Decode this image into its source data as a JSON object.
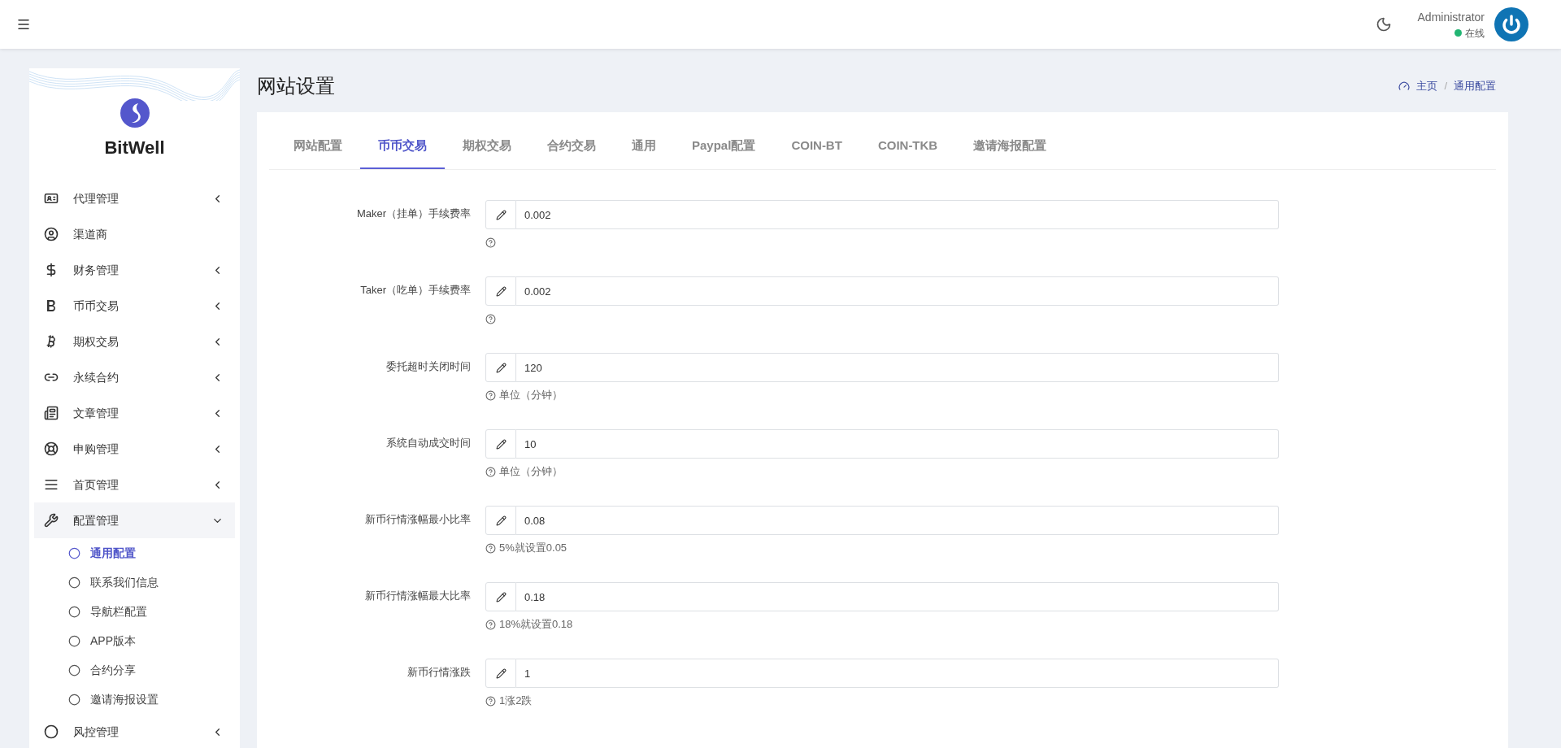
{
  "header": {
    "user_name": "Administrator",
    "status": "在线"
  },
  "sidebar": {
    "brand": "BitWell",
    "items": [
      {
        "label": "代理管理",
        "expandable": true,
        "expanded": false
      },
      {
        "label": "渠道商",
        "expandable": false
      },
      {
        "label": "财务管理",
        "expandable": true,
        "expanded": false
      },
      {
        "label": "币币交易",
        "expandable": true,
        "expanded": false
      },
      {
        "label": "期权交易",
        "expandable": true,
        "expanded": false
      },
      {
        "label": "永续合约",
        "expandable": true,
        "expanded": false
      },
      {
        "label": "文章管理",
        "expandable": true,
        "expanded": false
      },
      {
        "label": "申购管理",
        "expandable": true,
        "expanded": false
      },
      {
        "label": "首页管理",
        "expandable": true,
        "expanded": false
      },
      {
        "label": "配置管理",
        "expandable": true,
        "expanded": true,
        "children": [
          {
            "label": "通用配置",
            "selected": true
          },
          {
            "label": "联系我们信息",
            "selected": false
          },
          {
            "label": "导航栏配置",
            "selected": false
          },
          {
            "label": "APP版本",
            "selected": false
          },
          {
            "label": "合约分享",
            "selected": false
          },
          {
            "label": "邀请海报设置",
            "selected": false
          }
        ]
      },
      {
        "label": "风控管理",
        "expandable": true,
        "expanded": false
      }
    ]
  },
  "page": {
    "title": "网站设置",
    "breadcrumb": [
      "主页",
      "通用配置"
    ],
    "breadcrumb_separator": "/"
  },
  "tabs": [
    {
      "label": "网站配置",
      "selected": false
    },
    {
      "label": "币币交易",
      "selected": true
    },
    {
      "label": "期权交易",
      "selected": false
    },
    {
      "label": "合约交易",
      "selected": false
    },
    {
      "label": "通用",
      "selected": false
    },
    {
      "label": "Paypal配置",
      "selected": false
    },
    {
      "label": "COIN-BT",
      "selected": false
    },
    {
      "label": "COIN-TKB",
      "selected": false
    },
    {
      "label": "邀请海报配置",
      "selected": false
    }
  ],
  "fields": [
    {
      "label": "Maker（挂单）手续费率",
      "value": "0.002"
    },
    {
      "label": "Taker（吃单）手续费率",
      "value": "0.002"
    },
    {
      "label": "委托超时关闭时间",
      "value": "120",
      "help": "单位（分钟）"
    },
    {
      "label": "系统自动成交时间",
      "value": "10",
      "help": "单位（分钟）"
    },
    {
      "label": "新币行情涨幅最小比率",
      "value": "0.08",
      "help": "5%就设置0.05"
    },
    {
      "label": "新币行情涨幅最大比率",
      "value": "0.18",
      "help": "18%就设置0.18"
    },
    {
      "label": "新币行情涨跌",
      "value": "1",
      "help": "1涨2跌"
    }
  ]
}
